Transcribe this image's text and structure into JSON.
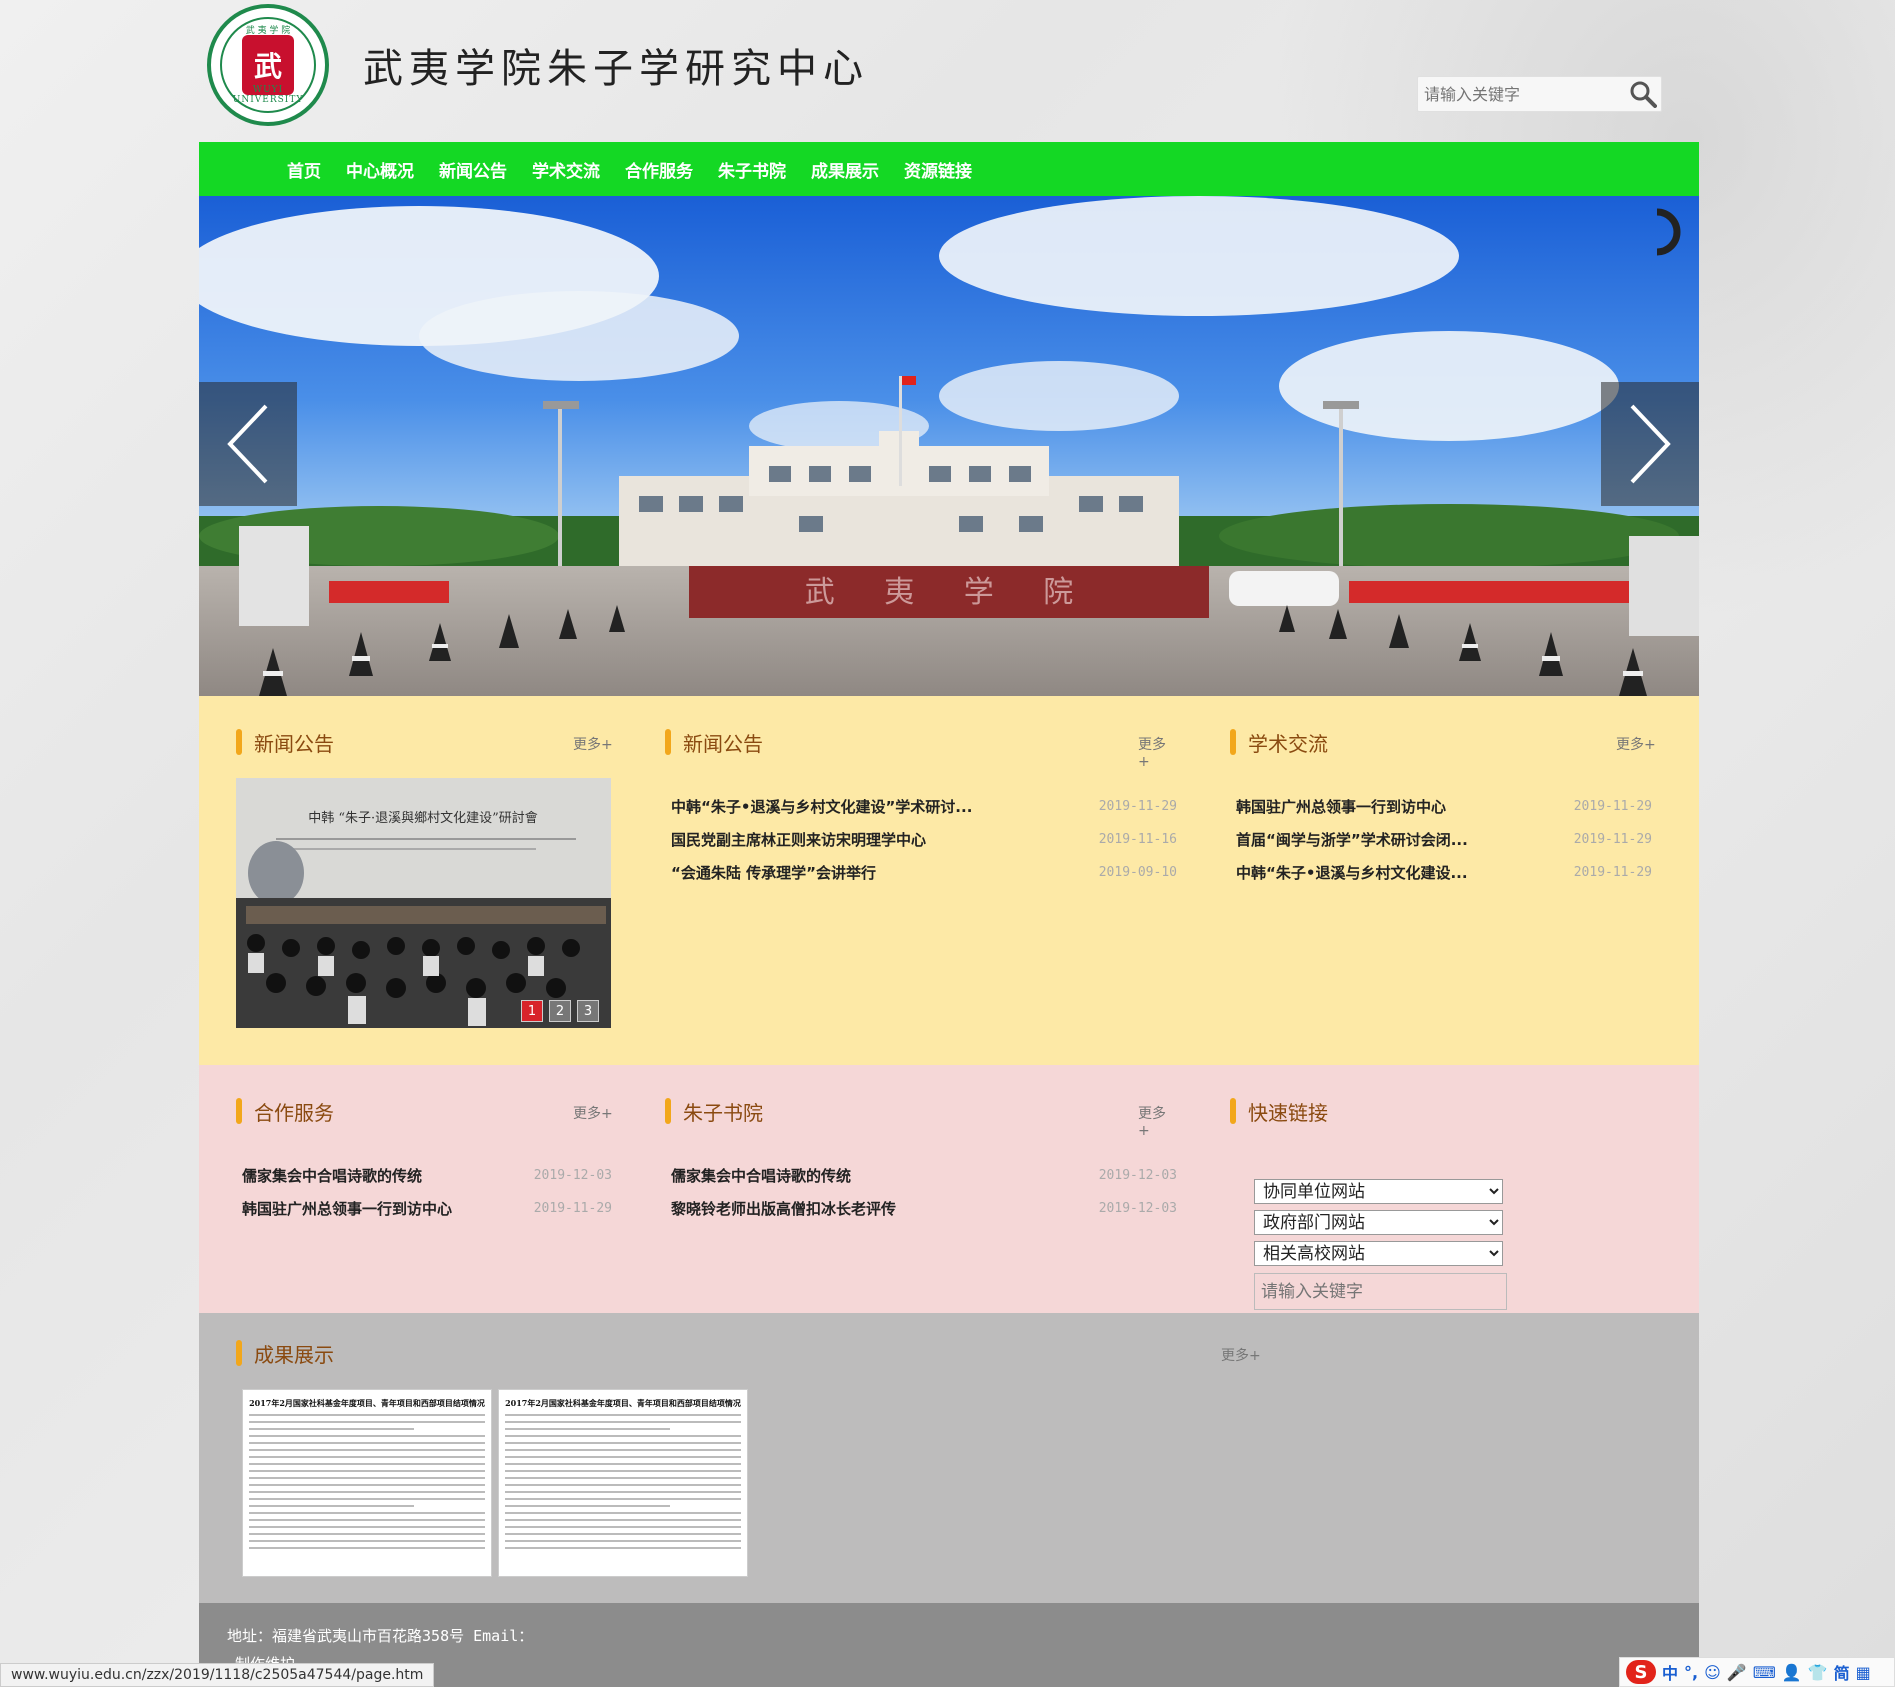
{
  "header": {
    "site_title": "武夷学院朱子学研究中心",
    "logo_text_top": "武 夷 学 院",
    "logo_seal": "武",
    "logo_ring": "WUYI UNIVERSITY",
    "search_placeholder": "请输入关键字"
  },
  "nav": {
    "items": [
      "首页",
      "中心概况",
      "新闻公告",
      "学术交流",
      "合作服务",
      "朱子书院",
      "成果展示",
      "资源链接"
    ]
  },
  "banner": {
    "gate_text": "武 夷 学 院"
  },
  "sections": {
    "news_photo": {
      "title": "新闻公告",
      "more": "更多+",
      "photo_banner": "中韩 “朱子·退溪與鄉村文化建设”研討會",
      "slides": [
        "1",
        "2",
        "3"
      ]
    },
    "news": {
      "title": "新闻公告",
      "more": "更多+",
      "items": [
        {
          "title": "中韩“朱子•退溪与乡村文化建设”学术研讨...",
          "date": "2019-11-29"
        },
        {
          "title": "国民党副主席林正则来访宋明理学中心",
          "date": "2019-11-16"
        },
        {
          "title": "“会通朱陆 传承理学”会讲举行",
          "date": "2019-09-10"
        }
      ]
    },
    "academic": {
      "title": "学术交流",
      "more": "更多+",
      "items": [
        {
          "title": "韩国驻广州总领事一行到访中心",
          "date": "2019-11-29"
        },
        {
          "title": "首届“闽学与浙学”学术研讨会闭...",
          "date": "2019-11-29"
        },
        {
          "title": "中韩“朱子•退溪与乡村文化建设...",
          "date": "2019-11-29"
        }
      ]
    },
    "cooperation": {
      "title": "合作服务",
      "more": "更多+",
      "items": [
        {
          "title": "儒家集会中合唱诗歌的传统",
          "date": "2019-12-03"
        },
        {
          "title": "韩国驻广州总领事一行到访中心",
          "date": "2019-11-29"
        }
      ]
    },
    "academy": {
      "title": "朱子书院",
      "more": "更多+",
      "items": [
        {
          "title": "儒家集会中合唱诗歌的传统",
          "date": "2019-12-03"
        },
        {
          "title": "黎晓铃老师出版高僧扣冰长老评传",
          "date": "2019-12-03"
        }
      ]
    },
    "quick_links": {
      "title": "快速链接",
      "selects": [
        "协同单位网站",
        "政府部门网站",
        "相关高校网站"
      ],
      "search_placeholder": "请输入关键字"
    },
    "achievements": {
      "title": "成果展示",
      "more": "更多+",
      "docs": [
        {
          "title": "2017年2月国家社科基金年度项目、青年项目和西部项目结项情况"
        },
        {
          "title": "2017年2月国家社科基金年度项目、青年项目和西部项目结项情况"
        }
      ]
    }
  },
  "footer": {
    "address": "地址：福建省武夷山市百花路358号 Email：",
    "maker": "制作维护"
  },
  "status_bar": {
    "url": "www.wuyiu.edu.cn/zzx/2019/1118/c2505a47544/page.htm"
  },
  "ime": {
    "logo": "S",
    "mode": "中",
    "punct": "°,",
    "simplified": "简"
  },
  "colors": {
    "nav_green": "#14d824",
    "yellow_section": "#fde9a6",
    "pink_section": "#f5d7d7",
    "grey_section": "#bdbcbc",
    "footer": "#8c8c8c",
    "accent_bar": "#f2a71b"
  }
}
